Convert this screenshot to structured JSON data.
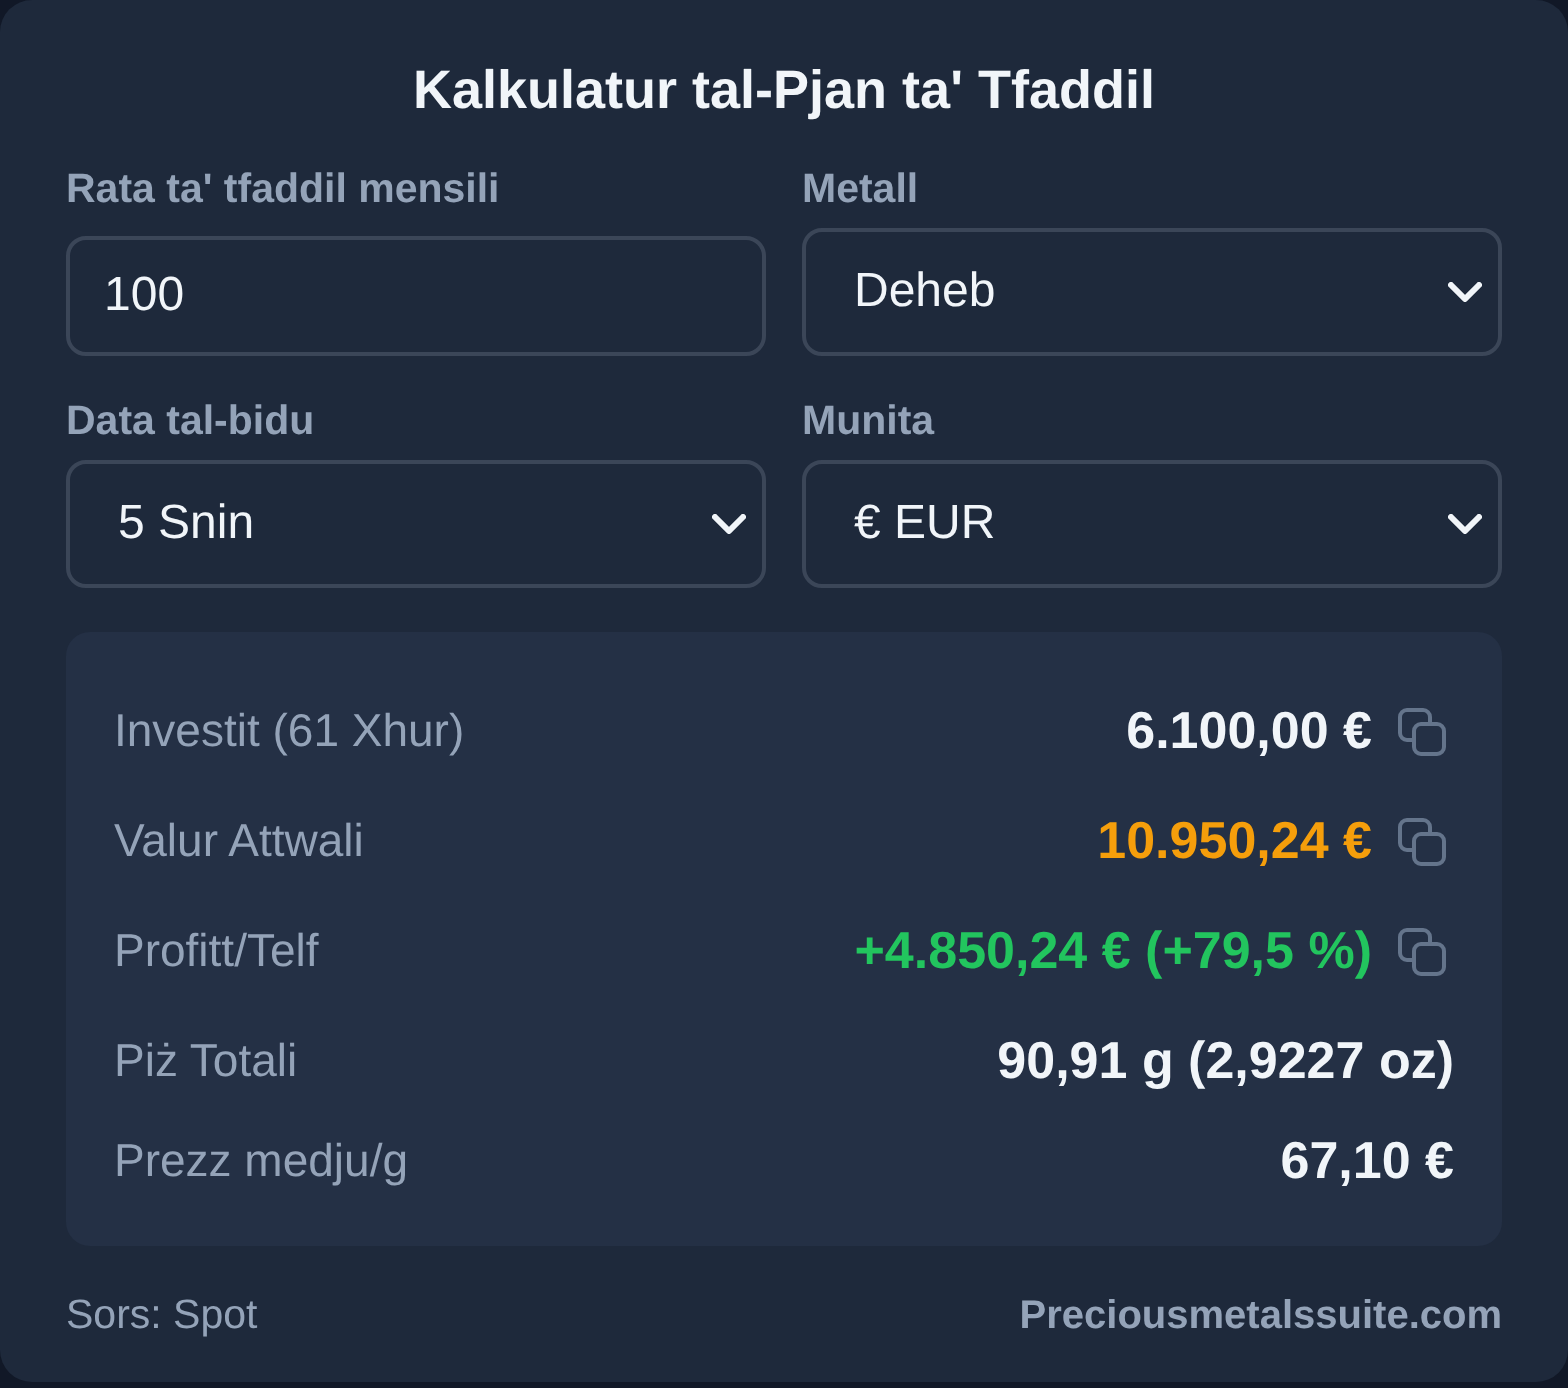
{
  "title": "Kalkulatur tal-Pjan ta' Tfaddil",
  "fields": [
    {
      "kind": "input",
      "label": "Rata ta' tfaddil mensili",
      "value": "100"
    },
    {
      "kind": "select",
      "label": "Metall",
      "value": "Deheb"
    },
    {
      "kind": "select",
      "label": "Data tal-bidu",
      "value": "5 Snin"
    },
    {
      "kind": "select",
      "label": "Munita",
      "value": "€ EUR"
    }
  ],
  "results": [
    {
      "label": "Investit (61 Xhur)",
      "value": "6.100,00 €",
      "color": "#f1f5f9",
      "copyable": true
    },
    {
      "label": "Valur Attwali",
      "value": "10.950,24 €",
      "color": "#f59e0b",
      "copyable": true
    },
    {
      "label": "Profitt/Telf",
      "value": "+4.850,24 € (+79,5 %)",
      "color": "#22c55e",
      "copyable": true
    },
    {
      "label": "Piż Totali",
      "value": "90,91 g (2,9227 oz)",
      "color": "#f1f5f9",
      "copyable": false
    },
    {
      "label": "Prezz medju/g",
      "value": "67,10 €",
      "color": "#f1f5f9",
      "copyable": false
    }
  ],
  "footer": {
    "source": "Sors: Spot",
    "link": "Preciousmetalssuite.com"
  }
}
